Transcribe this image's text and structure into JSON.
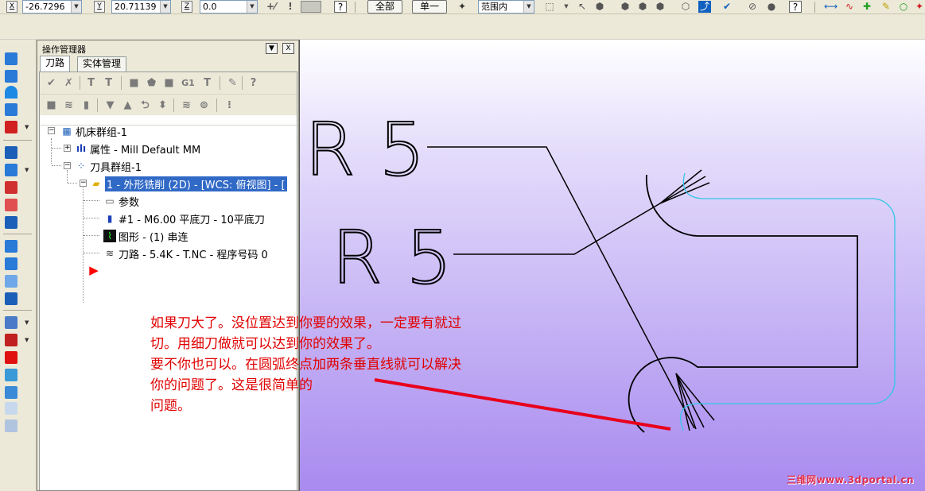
{
  "toolbar": {
    "x_label": "X",
    "x_value": "-26.7296",
    "y_label": "Y",
    "y_value": "20.71139",
    "z_label": "Z",
    "z_value": "0.0",
    "all_label": "全部",
    "single_label": "单一",
    "range_value": "范围内"
  },
  "opmgr": {
    "title": "操作管理器",
    "min_label": "▼",
    "close_label": "X",
    "tabs": [
      "刀路",
      "实体管理"
    ]
  },
  "tree": {
    "machine_group": "机床群组-1",
    "properties": "属性 - Mill Default MM",
    "tool_group": "刀具群组-1",
    "operation": "1 - 外形铣削 (2D) - [WCS: 俯视图] - [",
    "params": "参数",
    "tool": "#1 - M6.00 平底刀 - 10平底刀",
    "geometry": "图形 - (1) 串连",
    "toolpath": "刀路 - 5.4K - T.NC - 程序号码 0"
  },
  "canvas": {
    "label_r5_a": "R 5",
    "label_r5_b": "R 5",
    "note_lines": [
      "如果刀大了。没位置达到你要的效果，一定要有就过",
      "切。用细刀做就可以达到你的效果了。",
      "要不你也可以。在圆弧终点加两条垂直线就可以解决",
      "你的问题了。这是很简单的",
      "问题。"
    ],
    "watermark": "三维网www.3dportal.cn"
  },
  "colors": {
    "note_red": "#e00000",
    "selection_blue": "#3169c6",
    "contour_cyan": "#33c6e8"
  }
}
